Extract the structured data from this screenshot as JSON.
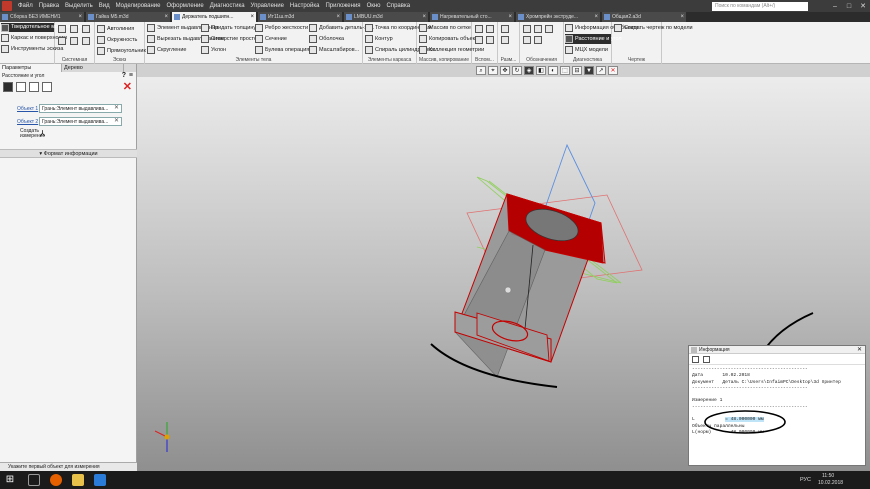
{
  "menubar": {
    "items": [
      "Файл",
      "Правка",
      "Выделить",
      "Вид",
      "Моделирование",
      "Оформление",
      "Диагностика",
      "Управление",
      "Настройка",
      "Приложения",
      "Окно",
      "Справка"
    ],
    "search_placeholder": "Поиск по командам (Alt+/)"
  },
  "tabs": [
    {
      "label": "Сборка БЕЗ ИМЕНИ1",
      "active": false
    },
    {
      "label": "Гайка М5.m3d",
      "active": false
    },
    {
      "label": "Держатель подшипн...",
      "active": true
    },
    {
      "label": "Ит11ш.m3d",
      "active": false
    },
    {
      "label": "LMBUU.m3d",
      "active": false
    },
    {
      "label": "Нагревательный сто...",
      "active": false
    },
    {
      "label": "Хромпрейн экструде...",
      "active": false
    },
    {
      "label": "Общая2.a3d",
      "active": false
    }
  ],
  "ribbon": {
    "mode_buttons": [
      "Твердотельное моделирование",
      "Каркас и поверхности",
      "Инструменты эскиза"
    ],
    "groups": {
      "g1": "Системная",
      "g2": "Эскиз",
      "g3": "Элементы тела",
      "g4": "Элементы каркаса",
      "g5": "Массив, копирование",
      "g6": "Вспом...",
      "g7": "Разм...",
      "g8": "Обозначения",
      "g9": "Диагностика",
      "g10": "Чертеж"
    },
    "sketch": [
      "Автолиния",
      "Окружность",
      "Прямоугольник"
    ],
    "body": [
      "Элемент выдавливания",
      "Вырезать выдавливанием",
      "Скругление",
      "Придать толщину",
      "Отверстие простое",
      "Уклон",
      "Ребро жесткости",
      "Сечение",
      "Булева операция",
      "Добавить деталь-за...",
      "Оболочка",
      "Масштабиров..."
    ],
    "wire": [
      "Точка по координатам",
      "Контур",
      "Спираль цилиндрическ..."
    ],
    "array": [
      "Массив по сетке",
      "Копировать объекты",
      "Коллекция геометрии"
    ],
    "diag": [
      "Информация об объекте",
      "Расстояние и угол",
      "МЦХ модели"
    ],
    "drawing": [
      "Создать чертеж по модели"
    ]
  },
  "left_panel": {
    "tabs": [
      "Параметры",
      "Дерево"
    ],
    "subtitle": "Расстояние и угол",
    "object1_label": "Объект 1",
    "object1_value": "Грань:Элемент выдавлива...",
    "object2_label": "Объект 2",
    "object2_value": "Грань:Элемент выдавлива...",
    "create_label": "Создать измерение",
    "format_section": "Формат информации"
  },
  "status": "Укажите первый объект для измерения",
  "info_window": {
    "title": "Информация",
    "date_label": "Дата",
    "date_value": "10.02.2018",
    "doc_label": "Документ",
    "doc_value": "Деталь C:\\Users\\InfaimPC\\Desktop\\3d принтер",
    "measure": "Измерение 1",
    "l_label": "L",
    "l_value": "= 48.000000 мм",
    "objects": "Объекты параллельны",
    "lnorm_label": "L(норм)",
    "lnorm_value": "= 48.000000 мм"
  },
  "taskbar": {
    "lang": "РУС",
    "time": "11:50",
    "date": "10.02.2018"
  },
  "colors": {
    "model_edge": "#c40000",
    "plane_red": "#e07070",
    "plane_blue": "#5b8fe0",
    "plane_green": "#8fcf5a"
  }
}
